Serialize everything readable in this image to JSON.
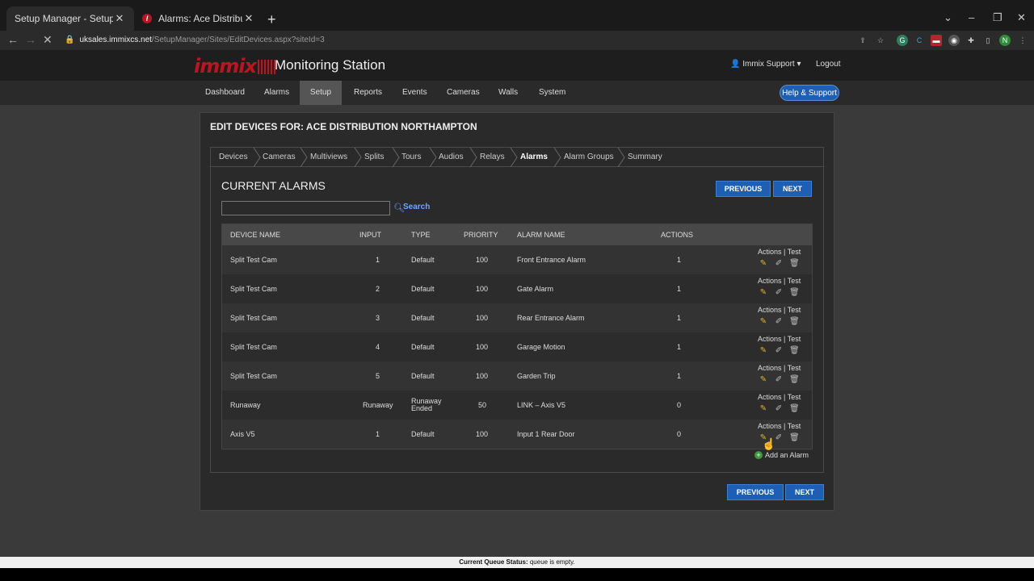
{
  "browser": {
    "tabs": [
      {
        "title": "Setup Manager - Setup: Devices",
        "close": "✕"
      },
      {
        "title": "Alarms: Ace Distribution Northampton",
        "close": "✕",
        "favicon": "I"
      }
    ],
    "new_tab": "+",
    "url_host": "uksales.immixcs.net",
    "url_path": "/SetupManager/Sites/EditDevices.aspx?siteId=3",
    "profile_initial": "N"
  },
  "app": {
    "logo_text": "immix",
    "title": "Monitoring Station",
    "user_label": "Immix Support",
    "logout_label": "Logout",
    "help_label": "Help & Support",
    "nav": [
      "Dashboard",
      "Alarms",
      "Setup",
      "Reports",
      "Events",
      "Cameras",
      "Walls",
      "System"
    ],
    "active_nav": "Setup"
  },
  "panel": {
    "heading": "EDIT DEVICES FOR: ACE DISTRIBUTION NORTHAMPTON",
    "crumbs": [
      "Devices",
      "Cameras",
      "Multiviews",
      "Splits",
      "Tours",
      "Audios",
      "Relays",
      "Alarms",
      "Alarm Groups",
      "Summary"
    ],
    "active_crumb": "Alarms",
    "section_title": "CURRENT ALARMS",
    "search_placeholder": "",
    "search_label": "Search",
    "previous_label": "PREVIOUS",
    "next_label": "NEXT",
    "add_alarm_label": "Add an Alarm"
  },
  "table": {
    "headers": [
      "DEVICE NAME",
      "INPUT",
      "TYPE",
      "PRIORITY",
      "ALARM NAME",
      "ACTIONS"
    ],
    "actions_text": "Actions | Test",
    "rows": [
      {
        "device": "Split Test Cam",
        "input": "1",
        "type": "Default",
        "priority": "100",
        "alarm": "Front Entrance Alarm",
        "actions": "1"
      },
      {
        "device": "Split Test Cam",
        "input": "2",
        "type": "Default",
        "priority": "100",
        "alarm": "Gate Alarm",
        "actions": "1"
      },
      {
        "device": "Split Test Cam",
        "input": "3",
        "type": "Default",
        "priority": "100",
        "alarm": "Rear Entrance Alarm",
        "actions": "1"
      },
      {
        "device": "Split Test Cam",
        "input": "4",
        "type": "Default",
        "priority": "100",
        "alarm": "Garage Motion",
        "actions": "1"
      },
      {
        "device": "Split Test Cam",
        "input": "5",
        "type": "Default",
        "priority": "100",
        "alarm": "Garden Trip",
        "actions": "1"
      },
      {
        "device": "Runaway",
        "input": "Runaway",
        "type": "Runaway Ended",
        "priority": "50",
        "alarm": "LINK – Axis V5",
        "actions": "0"
      },
      {
        "device": "Axis V5",
        "input": "1",
        "type": "Default",
        "priority": "100",
        "alarm": "Input 1 Rear Door",
        "actions": "0"
      }
    ]
  },
  "status": {
    "label": "Current Queue Status:",
    "value": "queue is empty."
  },
  "colors": {
    "accent": "#1d5fb4",
    "brand": "#c0121f",
    "edit_icon": "#e2b71a"
  }
}
